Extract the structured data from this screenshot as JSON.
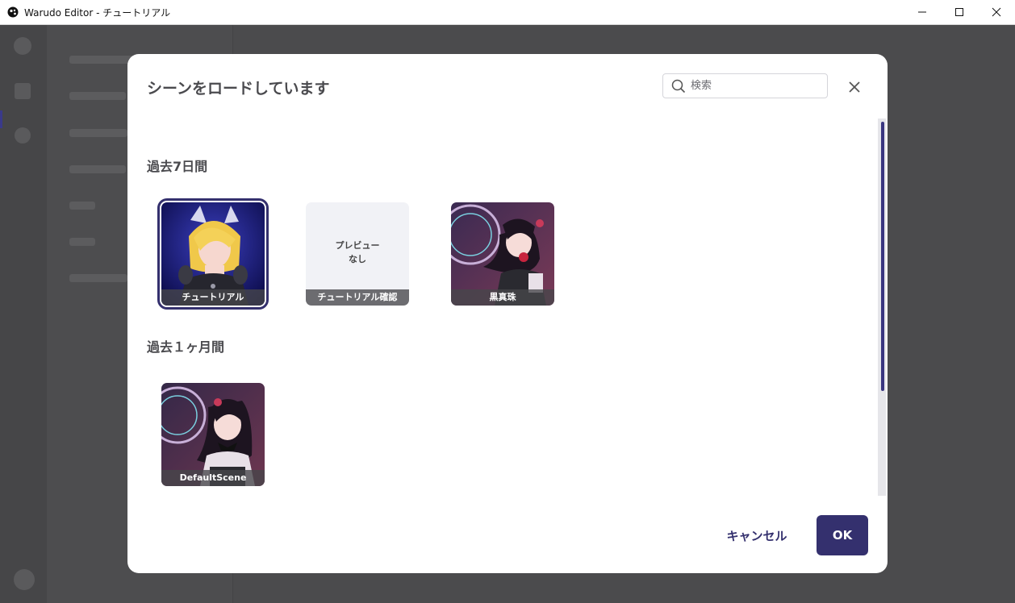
{
  "window": {
    "title": "Warudo Editor - チュートリアル",
    "minimize_icon": "minimize-icon",
    "maximize_icon": "maximize-icon",
    "close_icon": "close-icon"
  },
  "dialog": {
    "title": "シーンをロードしています",
    "search": {
      "placeholder": "検索",
      "value": ""
    },
    "sections": [
      {
        "heading": "過去7日間",
        "scenes": [
          {
            "name": "チュートリアル",
            "selected": true,
            "has_preview": true
          },
          {
            "name": "チュートリアル確認",
            "selected": false,
            "has_preview": false,
            "no_preview_text": "プレビュー\nなし"
          },
          {
            "name": "黒真珠",
            "selected": false,
            "has_preview": true
          }
        ]
      },
      {
        "heading": "過去１ヶ月間",
        "scenes": [
          {
            "name": "DefaultScene",
            "selected": false,
            "has_preview": true
          }
        ]
      }
    ],
    "cancel_label": "キャンセル",
    "ok_label": "OK"
  },
  "colors": {
    "accent": "#34306e",
    "backdrop": "#4b4b4d",
    "dialog_bg": "#ffffff"
  }
}
